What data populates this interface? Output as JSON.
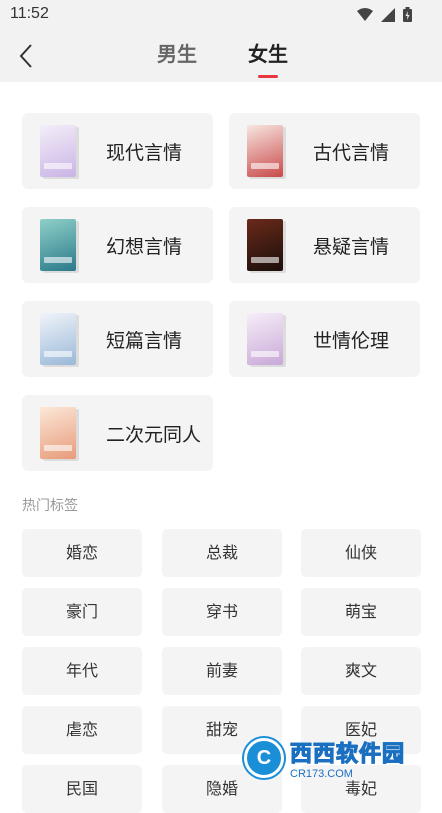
{
  "status_bar": {
    "time": "11:52",
    "icons": [
      "wifi-icon",
      "signal-icon",
      "battery-icon"
    ]
  },
  "header": {
    "tabs": [
      {
        "label": "男生",
        "active": false
      },
      {
        "label": "女生",
        "active": true
      }
    ],
    "accent_color": "#e8363f"
  },
  "categories": [
    {
      "label": "现代言情",
      "cover_color": "#c9b4e6"
    },
    {
      "label": "古代言情",
      "cover_color": "#c94a4a"
    },
    {
      "label": "幻想言情",
      "cover_color": "#3a9a9a"
    },
    {
      "label": "悬疑言情",
      "cover_color": "#3a1e1a"
    },
    {
      "label": "短篇言情",
      "cover_color": "#9ab8d8"
    },
    {
      "label": "世情伦理",
      "cover_color": "#c9a8d8"
    },
    {
      "label": "二次元同人",
      "cover_color": "#e89a7a"
    }
  ],
  "hot_tags": {
    "title": "热门标签",
    "items": [
      "婚恋",
      "总裁",
      "仙侠",
      "豪门",
      "穿书",
      "萌宝",
      "年代",
      "前妻",
      "爽文",
      "虐恋",
      "甜宠",
      "医妃",
      "民国",
      "隐婚",
      "毒妃"
    ]
  },
  "watermark": {
    "main": "西西软件园",
    "sub": "CR173.COM",
    "logo": "C"
  }
}
